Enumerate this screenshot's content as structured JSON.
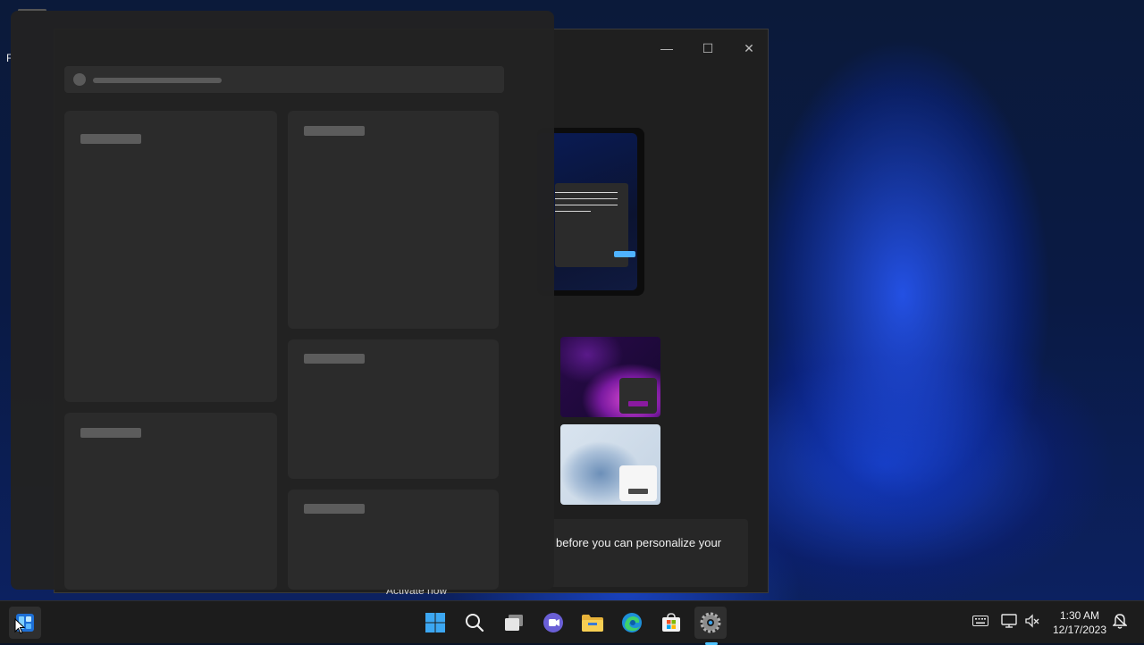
{
  "desktop": {
    "partial_label": "F"
  },
  "settings_window": {
    "controls": {
      "minimize_glyph": "—",
      "maximize_glyph": "☐",
      "close_glyph": "✕"
    },
    "activate_message": "before you can personalize your",
    "activate_link": "Activate now"
  },
  "widgets_panel": {
    "state": "loading"
  },
  "taskbar": {
    "icons": [
      {
        "name": "widgets-icon"
      },
      {
        "name": "start-icon"
      },
      {
        "name": "search-icon"
      },
      {
        "name": "task-view-icon"
      },
      {
        "name": "chat-icon"
      },
      {
        "name": "file-explorer-icon"
      },
      {
        "name": "edge-icon"
      },
      {
        "name": "store-icon"
      },
      {
        "name": "settings-icon"
      }
    ],
    "tray": {
      "keyboard_icon": "keyboard-icon",
      "network_icon": "network-icon",
      "volume_icon": "volume-muted-icon",
      "notification_icon": "notification-icon"
    },
    "clock": {
      "time": "1:30 AM",
      "date": "12/17/2023"
    }
  },
  "colors": {
    "accent": "#4cc2ff",
    "taskbar_bg": "#1c1c1c",
    "panel_bg": "#222222"
  }
}
